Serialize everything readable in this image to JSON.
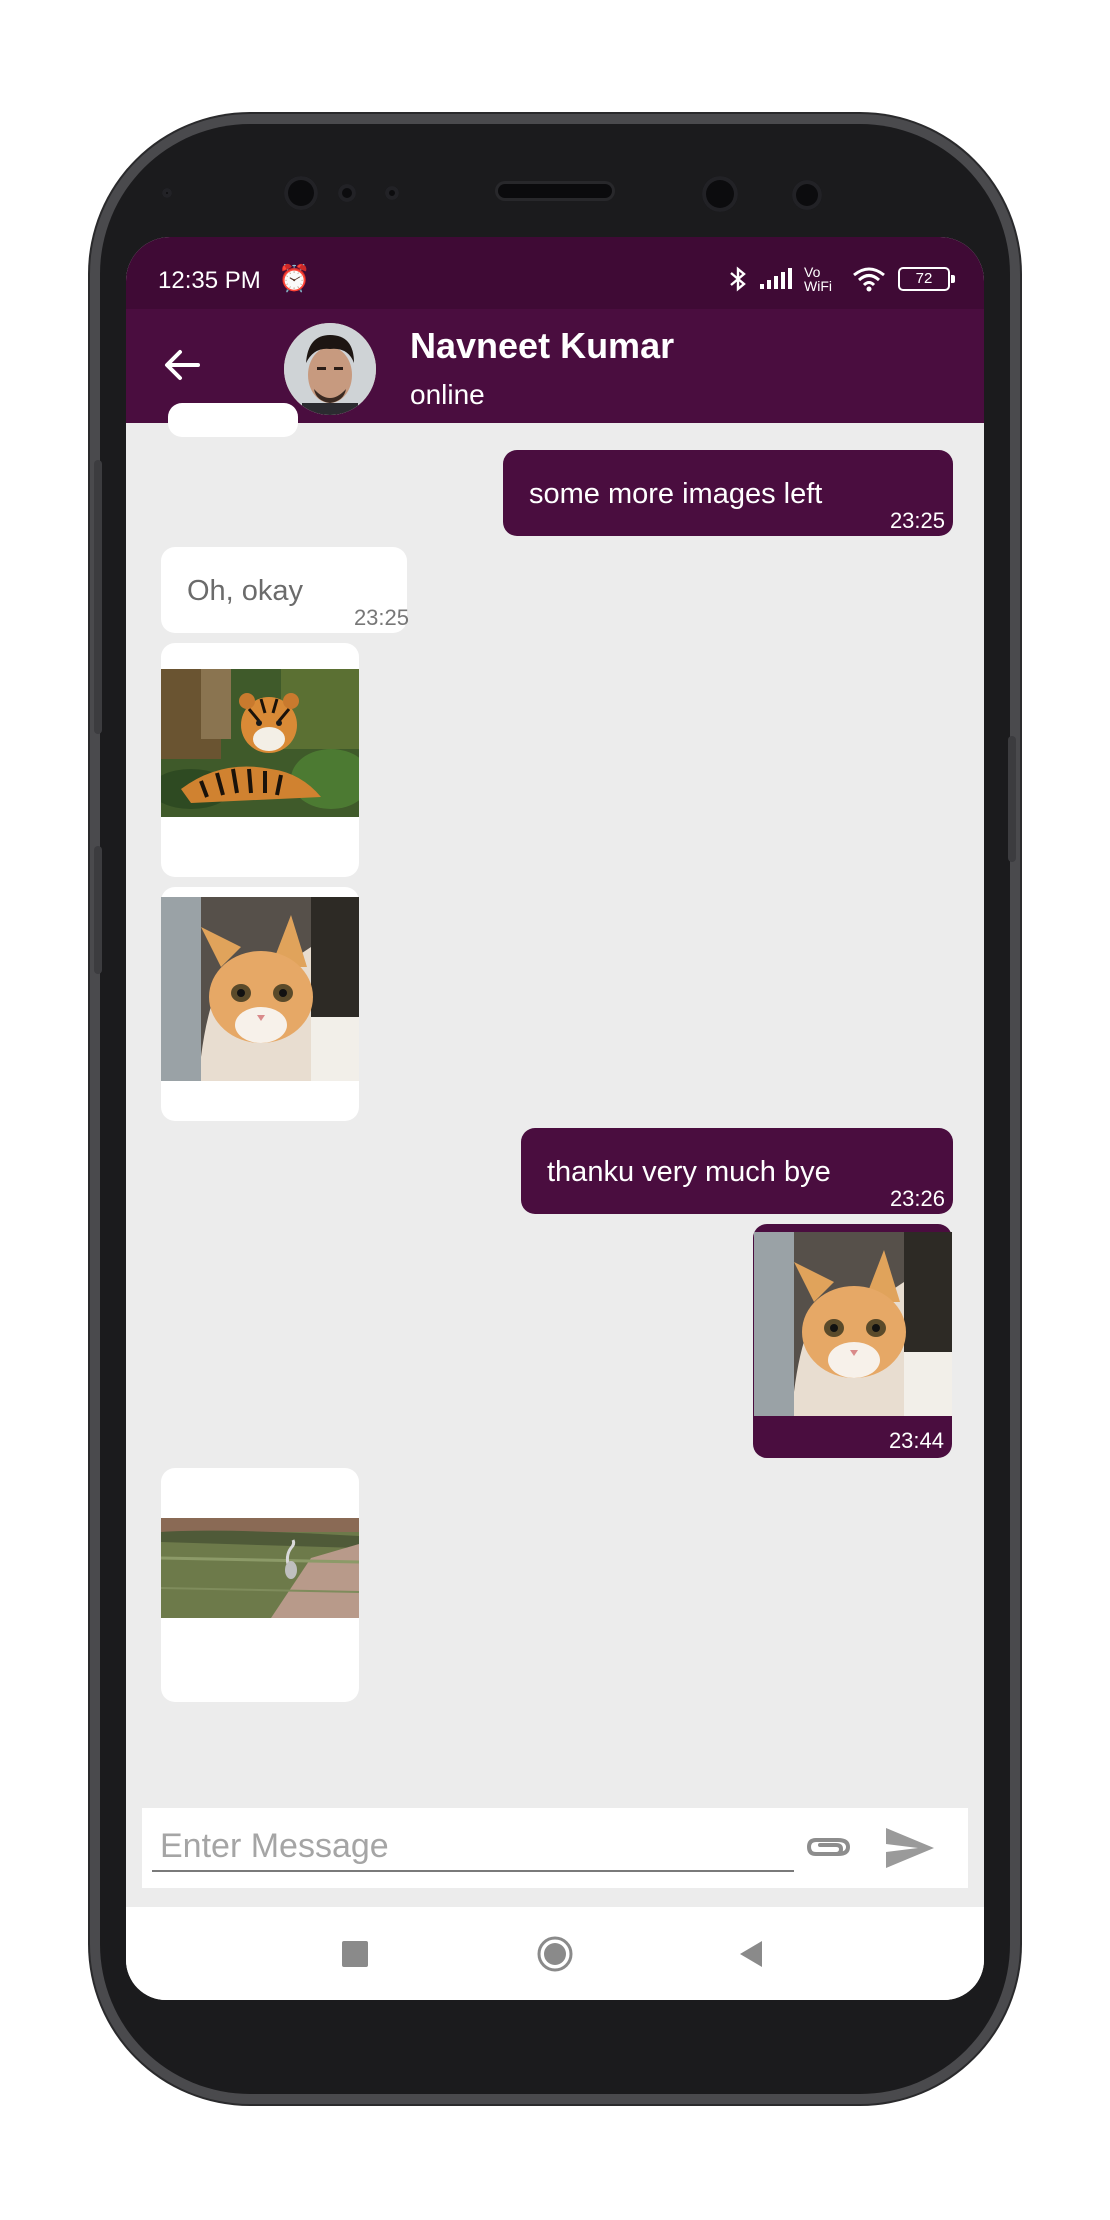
{
  "status_bar": {
    "time": "12:35 PM",
    "alarm_icon": "alarm-clock-icon",
    "network_label": "Vo WiFi",
    "battery_level": "72"
  },
  "chat_header": {
    "contact_name": "Navneet Kumar",
    "presence": "online"
  },
  "messages": [
    {
      "direction": "sent",
      "kind": "text",
      "text": "some more images left",
      "time": "23:25"
    },
    {
      "direction": "received",
      "kind": "text",
      "text": "Oh, okay",
      "time": "23:25"
    },
    {
      "direction": "received",
      "kind": "image",
      "image": "tiger"
    },
    {
      "direction": "received",
      "kind": "image",
      "image": "kitten"
    },
    {
      "direction": "sent",
      "kind": "text",
      "text": "thanku very much bye",
      "time": "23:26"
    },
    {
      "direction": "sent",
      "kind": "image",
      "image": "kitten",
      "time": "23:44"
    },
    {
      "direction": "received",
      "kind": "image",
      "image": "heron by water"
    }
  ],
  "composer": {
    "placeholder": "Enter Message"
  },
  "colors": {
    "primary": "#4a0d3f",
    "status_bar": "#3f0a35",
    "chat_background": "#ececec"
  }
}
